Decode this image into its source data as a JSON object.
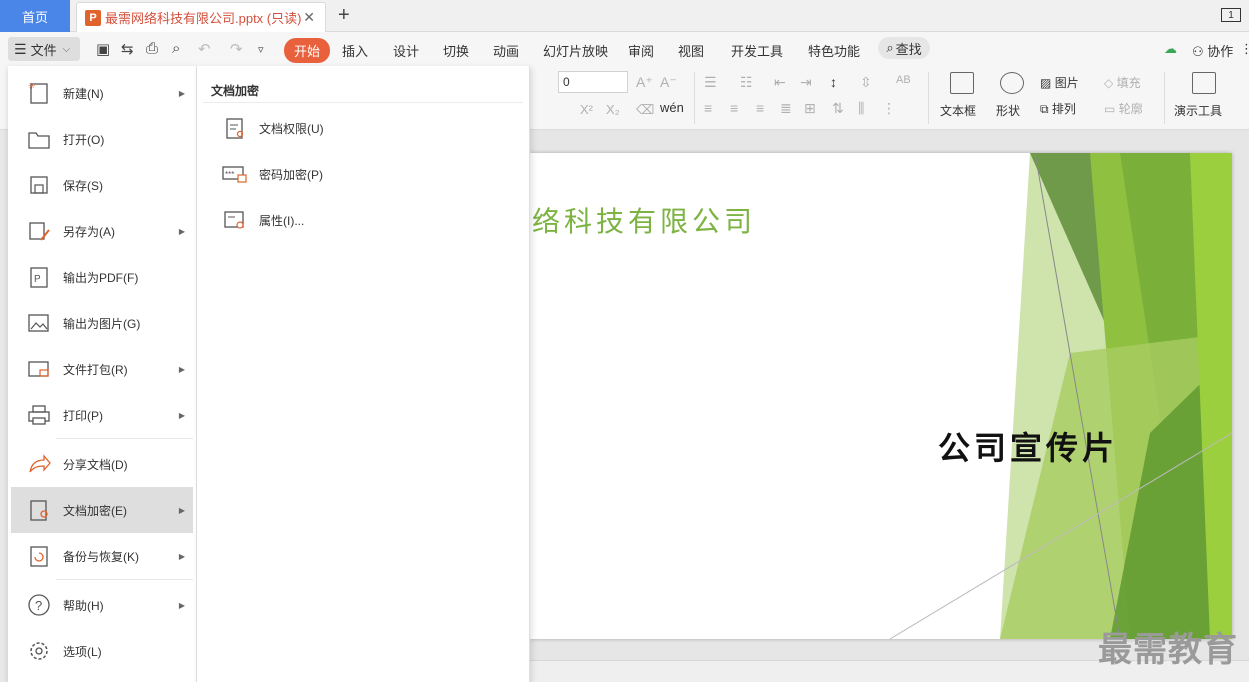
{
  "tabs": {
    "home": "首页",
    "document": "最需网络科技有限公司.pptx (只读)",
    "close": "✕",
    "add": "+",
    "window_badge": "1"
  },
  "menubar": {
    "file_label": "文件",
    "ribbon_tabs": [
      "开始",
      "插入",
      "设计",
      "切换",
      "动画",
      "幻灯片放映",
      "审阅",
      "视图",
      "开发工具",
      "特色功能"
    ],
    "search_label": "查找",
    "collab_label": "协作"
  },
  "ribbon": {
    "font_size_value": "0",
    "text_box": "文本框",
    "shape": "形状",
    "picture": "图片",
    "fill": "填充",
    "arrange": "排列",
    "outline": "轮廓",
    "present_tools": "演示工具"
  },
  "file_menu": {
    "items": [
      {
        "label": "新建(N)",
        "arrow": "▶"
      },
      {
        "label": "打开(O)",
        "arrow": ""
      },
      {
        "label": "保存(S)",
        "arrow": ""
      },
      {
        "label": "另存为(A)",
        "arrow": "▶"
      },
      {
        "label": "输出为PDF(F)",
        "arrow": ""
      },
      {
        "label": "输出为图片(G)",
        "arrow": ""
      },
      {
        "label": "文件打包(R)",
        "arrow": "▶"
      },
      {
        "label": "打印(P)",
        "arrow": "▶"
      },
      {
        "label": "分享文档(D)",
        "arrow": ""
      },
      {
        "label": "文档加密(E)",
        "arrow": "▶"
      },
      {
        "label": "备份与恢复(K)",
        "arrow": "▶"
      },
      {
        "label": "帮助(H)",
        "arrow": "▶"
      },
      {
        "label": "选项(L)",
        "arrow": ""
      }
    ]
  },
  "submenu": {
    "heading": "文档加密",
    "items": [
      {
        "label": "文档权限(U)"
      },
      {
        "label": "密码加密(P)"
      },
      {
        "label": "属性(I)..."
      }
    ]
  },
  "slide": {
    "company_fragment": "络科技有限公司",
    "title": "公司宣传片",
    "accent_green": "#7cb342"
  },
  "watermark": "最需教育"
}
